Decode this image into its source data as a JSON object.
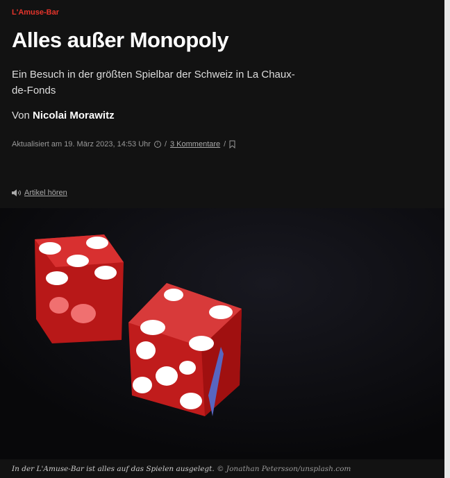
{
  "kicker": "L'Amuse-Bar",
  "title": "Alles außer Monopoly",
  "lead": "Ein Besuch in der größten Spielbar der Schweiz in La Chaux-de-Fonds",
  "author": {
    "prefix": "Von",
    "name": "Nicolai Morawitz"
  },
  "meta": {
    "updated": "Aktualisiert am 19. März 2023, 14:53 Uhr",
    "comments": "3 Kommentare",
    "sep": "/"
  },
  "listen": "Artikel hören",
  "caption": {
    "text": "In der L'Amuse-Bar ist alles auf das Spielen ausgelegt.",
    "credit": "© Jonathan Petersson/unsplash.com"
  },
  "colors": {
    "accent": "#e5342b",
    "bg": "#121212"
  }
}
